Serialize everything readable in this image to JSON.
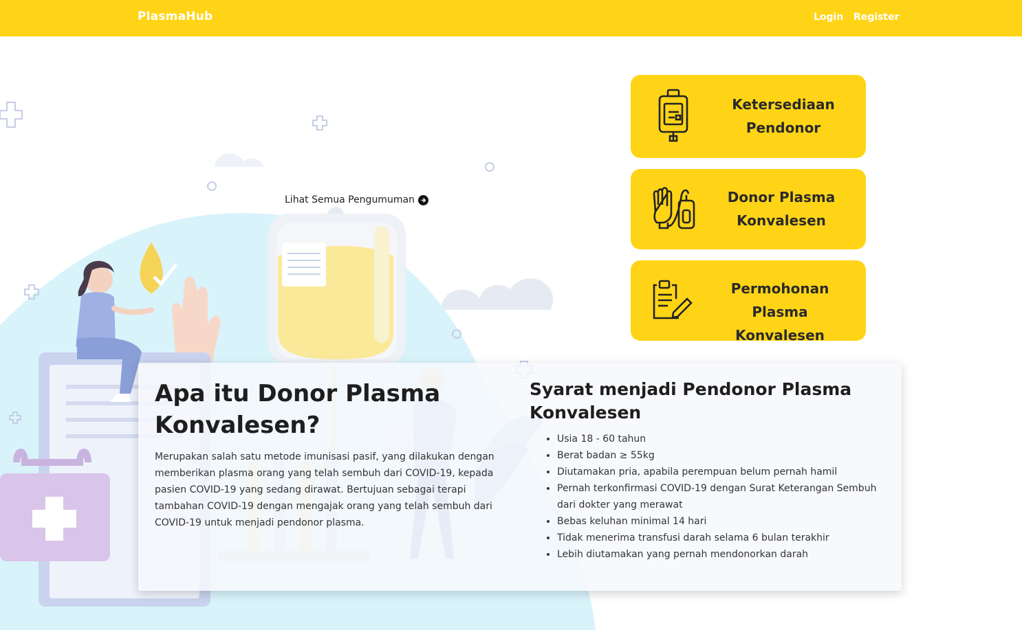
{
  "navbar": {
    "brand": "PlasmaHub",
    "login_label": "Login",
    "register_label": "Register",
    "background_color": "#ffd416"
  },
  "hero": {
    "announcement_link": "Lihat Semua Pengumuman",
    "announcement_icon": "arrow-right-circle-icon"
  },
  "menu_cards": [
    {
      "line1": "Ketersediaan",
      "line2": "Pendonor",
      "icon": "blood-bag-icon"
    },
    {
      "line1": "Donor Plasma",
      "line2": "Konvalesen",
      "icon": "donation-hand-icon"
    },
    {
      "line1": "Permohonan Plasma",
      "line2": "Konvalesen",
      "icon": "clipboard-pen-icon"
    }
  ],
  "info": {
    "left_title": "Apa itu Donor Plasma Konvalesen?",
    "left_text": "Merupakan salah satu metode imunisasi pasif, yang dilakukan dengan memberikan plasma orang yang telah sembuh dari COVID-19, kepada pasien COVID-19 yang sedang dirawat. Bertujuan sebagai terapi tambahan COVID-19 dengan mengajak orang yang telah sembuh dari COVID-19 untuk menjadi pendonor plasma.",
    "right_title": "Syarat menjadi Pendonor Plasma Konvalesen",
    "requirements": [
      "Usia 18 - 60 tahun",
      "Berat badan ≥ 55kg",
      "Diutamakan pria, apabila perempuan belum pernah hamil",
      "Pernah terkonfirmasi COVID-19 dengan Surat Keterangan Sembuh dari dokter yang merawat",
      "Bebas keluhan minimal 14 hari",
      "Tidak menerima transfusi darah selama 6 bulan terakhir",
      "Lebih diutamakan yang pernah mendonorkan darah"
    ]
  }
}
